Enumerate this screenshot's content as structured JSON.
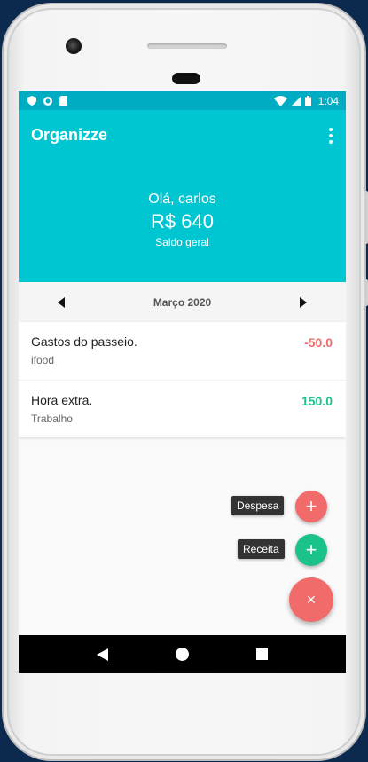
{
  "status": {
    "time": "1:04"
  },
  "app": {
    "title": "Organizze"
  },
  "summary": {
    "greeting": "Olá, carlos",
    "balance": "R$ 640",
    "balance_label": "Saldo geral"
  },
  "month": {
    "label": "Março 2020"
  },
  "transactions": [
    {
      "title": "Gastos do passeio.",
      "category": "ifood",
      "value": "-50.0",
      "color": "#f26b6b"
    },
    {
      "title": "Hora extra.",
      "category": "Trabalho",
      "value": "150.0",
      "color": "#1bc28a"
    }
  ],
  "fab": {
    "expense_label": "Despesa",
    "income_label": "Receita",
    "expense_icon": "+",
    "income_icon": "+",
    "close_icon": "×"
  },
  "colors": {
    "primary": "#00c6d2",
    "status_bar": "#00acc1",
    "expense": "#f26b6b",
    "income": "#1bc28a",
    "fab_main": "#f26b6b"
  }
}
